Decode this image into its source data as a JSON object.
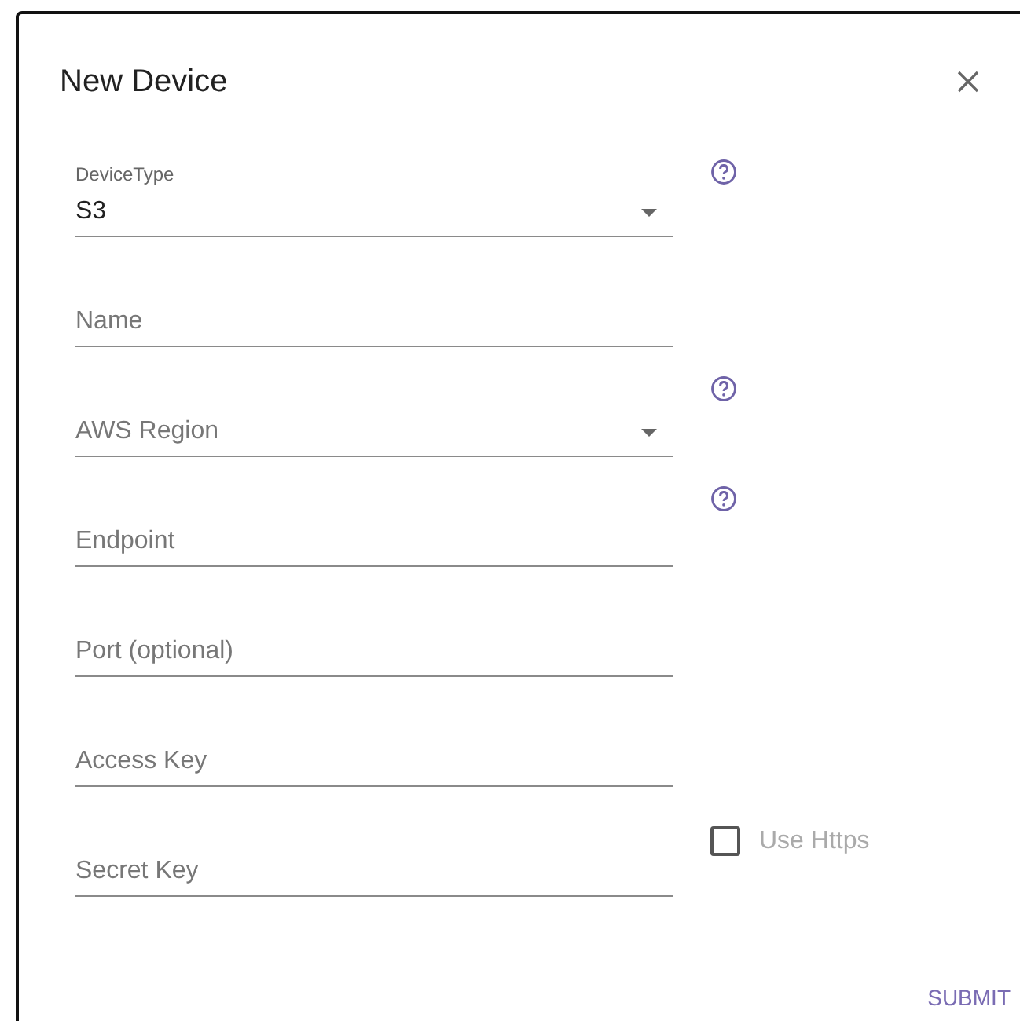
{
  "dialog": {
    "title": "New Device"
  },
  "fields": [
    {
      "kind": "select",
      "label": "DeviceType",
      "value": "S3",
      "help": true
    },
    {
      "kind": "text",
      "placeholder": "Name",
      "help": false
    },
    {
      "kind": "select",
      "placeholder": "AWS Region",
      "help": true
    },
    {
      "kind": "text",
      "placeholder": "Endpoint",
      "help": true
    },
    {
      "kind": "text",
      "placeholder": "Port (optional)",
      "help": false
    },
    {
      "kind": "text",
      "placeholder": "Access Key",
      "help": false
    },
    {
      "kind": "text",
      "placeholder": "Secret Key",
      "help": false
    }
  ],
  "https_option": {
    "label": "Use Https",
    "checked": false
  },
  "buttons": [
    {
      "label": "SUBMIT"
    }
  ]
}
